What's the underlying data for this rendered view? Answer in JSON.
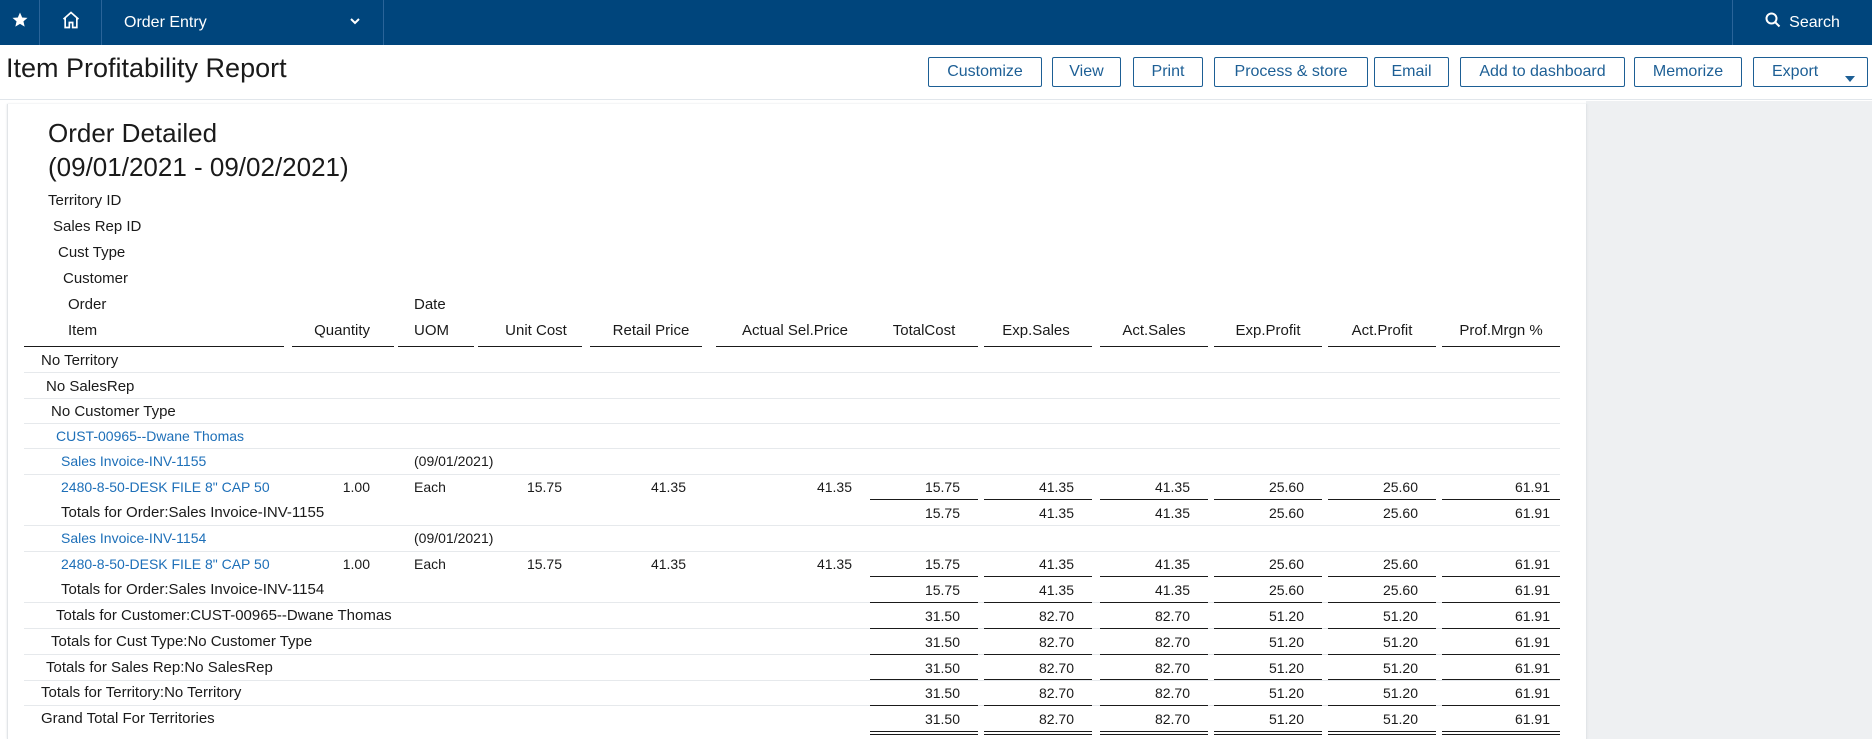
{
  "nav": {
    "module": "Order Entry",
    "search_label": "Search",
    "icons": [
      "star-icon",
      "home-icon",
      "chevron-down-icon",
      "search-icon"
    ]
  },
  "header": {
    "title": "Item Profitability Report",
    "buttons": {
      "customize": "Customize",
      "view": "View",
      "print": "Print",
      "process": "Process & store",
      "email": "Email",
      "dashboard": "Add to dashboard",
      "memorize": "Memorize",
      "export": "Export"
    }
  },
  "report": {
    "title": "Order Detailed",
    "period": "(09/01/2021 - 09/02/2021)",
    "group_labels": {
      "territory": "Territory ID",
      "salesrep": "Sales Rep ID",
      "custtype": "Cust Type",
      "customer": "Customer",
      "order": "Order",
      "item": "Item"
    },
    "columns": {
      "quantity": "Quantity",
      "date": "Date",
      "uom": "UOM",
      "unit_cost": "Unit Cost",
      "retail_price": "Retail Price",
      "actual_sel_price": "Actual Sel.Price",
      "total_cost": "TotalCost",
      "exp_sales": "Exp.Sales",
      "act_sales": "Act.Sales",
      "exp_profit": "Exp.Profit",
      "act_profit": "Act.Profit",
      "prof_mrgn": "Prof.Mrgn %"
    },
    "groups": {
      "territory": "No Territory",
      "salesrep": "No SalesRep",
      "custtype": "No Customer Type",
      "customer": "CUST-00965--Dwane Thomas"
    },
    "orders": [
      {
        "label": "Sales Invoice-INV-1155",
        "date": "(09/01/2021)",
        "item": {
          "name": "2480-8-50-DESK FILE 8\" CAP 50",
          "quantity": "1.00",
          "uom": "Each",
          "unit_cost": "15.75",
          "retail_price": "41.35",
          "actual_sel_price": "41.35",
          "total_cost": "15.75",
          "exp_sales": "41.35",
          "act_sales": "41.35",
          "exp_profit": "25.60",
          "act_profit": "25.60",
          "prof_mrgn": "61.91"
        },
        "total": {
          "label": "Totals for Order:Sales Invoice-INV-1155",
          "total_cost": "15.75",
          "exp_sales": "41.35",
          "act_sales": "41.35",
          "exp_profit": "25.60",
          "act_profit": "25.60",
          "prof_mrgn": "61.91"
        }
      },
      {
        "label": "Sales Invoice-INV-1154",
        "date": "(09/01/2021)",
        "item": {
          "name": "2480-8-50-DESK FILE 8\" CAP 50",
          "quantity": "1.00",
          "uom": "Each",
          "unit_cost": "15.75",
          "retail_price": "41.35",
          "actual_sel_price": "41.35",
          "total_cost": "15.75",
          "exp_sales": "41.35",
          "act_sales": "41.35",
          "exp_profit": "25.60",
          "act_profit": "25.60",
          "prof_mrgn": "61.91"
        },
        "total": {
          "label": "Totals for Order:Sales Invoice-INV-1154",
          "total_cost": "15.75",
          "exp_sales": "41.35",
          "act_sales": "41.35",
          "exp_profit": "25.60",
          "act_profit": "25.60",
          "prof_mrgn": "61.91"
        }
      }
    ],
    "totals": [
      {
        "label": "Totals for Customer:CUST-00965--Dwane Thomas",
        "total_cost": "31.50",
        "exp_sales": "82.70",
        "act_sales": "82.70",
        "exp_profit": "51.20",
        "act_profit": "51.20",
        "prof_mrgn": "61.91"
      },
      {
        "label": "Totals for Cust Type:No Customer Type",
        "total_cost": "31.50",
        "exp_sales": "82.70",
        "act_sales": "82.70",
        "exp_profit": "51.20",
        "act_profit": "51.20",
        "prof_mrgn": "61.91"
      },
      {
        "label": "Totals for Sales Rep:No SalesRep",
        "total_cost": "31.50",
        "exp_sales": "82.70",
        "act_sales": "82.70",
        "exp_profit": "51.20",
        "act_profit": "51.20",
        "prof_mrgn": "61.91"
      },
      {
        "label": "Totals for Territory:No Territory",
        "total_cost": "31.50",
        "exp_sales": "82.70",
        "act_sales": "82.70",
        "exp_profit": "51.20",
        "act_profit": "51.20",
        "prof_mrgn": "61.91"
      },
      {
        "label": "Grand Total For Territories",
        "total_cost": "31.50",
        "exp_sales": "82.70",
        "act_sales": "82.70",
        "exp_profit": "51.20",
        "act_profit": "51.20",
        "prof_mrgn": "61.91"
      }
    ]
  },
  "colors": {
    "nav": "#00457c",
    "accent": "#1d5f95",
    "link": "#1d6fb8"
  }
}
